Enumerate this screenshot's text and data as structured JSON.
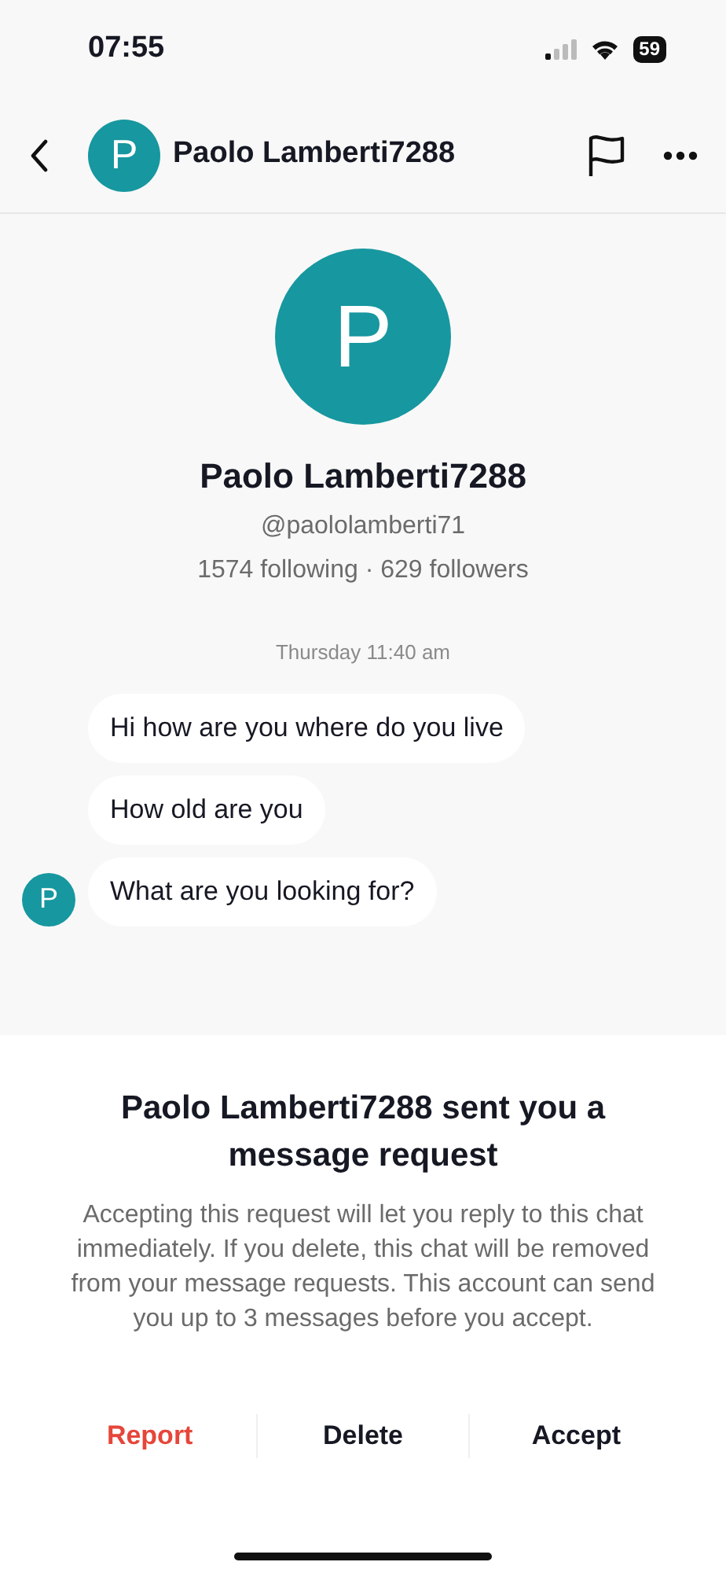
{
  "status_bar": {
    "time": "07:55",
    "battery": "59"
  },
  "header": {
    "avatar_letter": "P",
    "name": "Paolo Lamberti7288"
  },
  "profile": {
    "avatar_letter": "P",
    "name": "Paolo Lamberti7288",
    "handle": "@paololamberti71",
    "stats": "1574 following · 629 followers"
  },
  "timestamp": "Thursday 11:40 am",
  "messages": [
    {
      "text": "Hi how are you where do you live",
      "show_avatar": false
    },
    {
      "text": "How old are you",
      "show_avatar": false
    },
    {
      "text": "What are you looking for?",
      "show_avatar": true,
      "avatar_letter": "P"
    }
  ],
  "request_sheet": {
    "title": "Paolo Lamberti7288 sent you a message request",
    "body": "Accepting this request will let you reply to this chat immediately. If you delete, this chat will be removed from your message requests. This account can send you up to 3 messages before you accept.",
    "actions": [
      {
        "label": "Report",
        "kind": "danger"
      },
      {
        "label": "Delete",
        "kind": "default"
      },
      {
        "label": "Accept",
        "kind": "default"
      }
    ]
  }
}
